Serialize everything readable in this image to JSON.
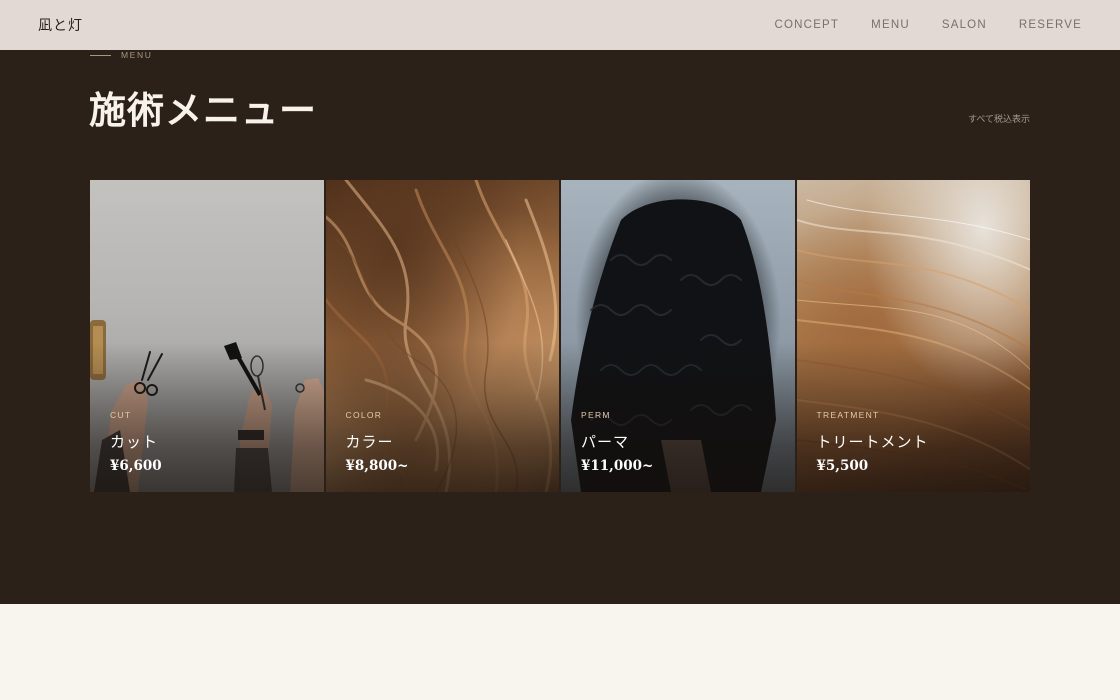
{
  "header": {
    "logo": "凪と灯",
    "nav": [
      "CONCEPT",
      "MENU",
      "SALON",
      "RESERVE"
    ]
  },
  "menu": {
    "eyebrow": "MENU",
    "title": "施術メニュー",
    "tax_note": "すべて税込表示",
    "cards": [
      {
        "category": "CUT",
        "name": "カット",
        "price": "¥6,600",
        "image": "scissors-brushes-hands"
      },
      {
        "category": "COLOR",
        "name": "カラー",
        "price": "¥8,800~",
        "image": "auburn-wavy-hair"
      },
      {
        "category": "PERM",
        "name": "パーマ",
        "price": "¥11,000~",
        "image": "dark-curly-hair"
      },
      {
        "category": "TREATMENT",
        "name": "トリートメント",
        "price": "¥5,500",
        "image": "glossy-brown-hair"
      }
    ]
  },
  "colors": {
    "nav_bg": "#e2d9d4",
    "section_bg": "#2b2118",
    "page_bg": "#f8f5ef",
    "accent": "#e2cba8"
  }
}
